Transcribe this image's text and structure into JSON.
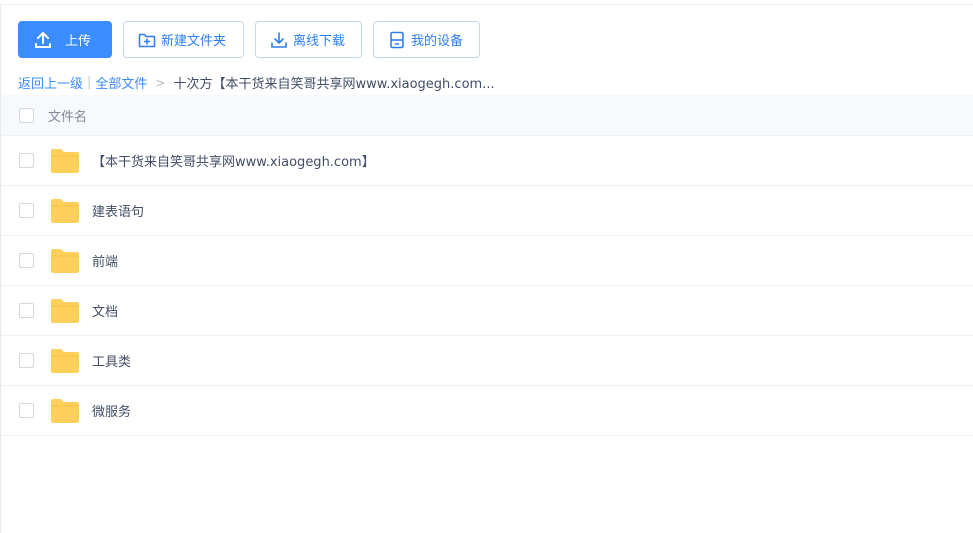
{
  "toolbar": {
    "upload_label": "上传",
    "new_folder_label": "新建文件夹",
    "offline_download_label": "离线下载",
    "my_devices_label": "我的设备"
  },
  "breadcrumb": {
    "back_label": "返回上一级",
    "separator": "|",
    "all_files_label": "全部文件",
    "arrow": ">",
    "current": "十次方【本干货来自笑哥共享网www.xiaogegh.com..."
  },
  "table": {
    "column_header": "文件名",
    "rows": [
      {
        "name": "【本干货来自笑哥共享网www.xiaogegh.com】",
        "type": "folder"
      },
      {
        "name": "建表语句",
        "type": "folder"
      },
      {
        "name": "前端",
        "type": "folder"
      },
      {
        "name": "文档",
        "type": "folder"
      },
      {
        "name": "工具类",
        "type": "folder"
      },
      {
        "name": "微服务",
        "type": "folder"
      }
    ]
  },
  "colors": {
    "primary": "#3b8cff",
    "folder": "#ffd15c",
    "text": "#424e67",
    "header_bg": "#f7f9fc"
  }
}
